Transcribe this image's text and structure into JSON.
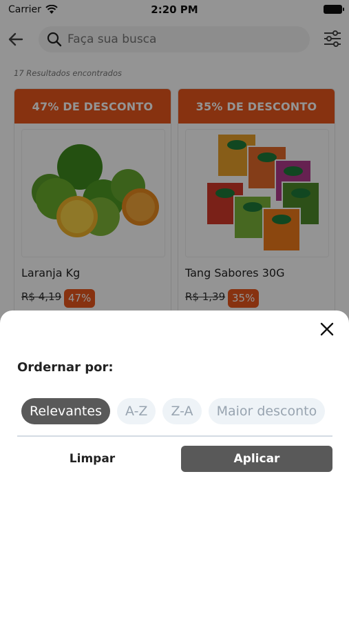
{
  "status_bar": {
    "carrier": "Carrier",
    "time": "2:20 PM"
  },
  "header": {
    "search_placeholder": "Faça sua busca"
  },
  "results_text": "17 Resultados encontrados",
  "products": [
    {
      "banner": "47% DE DESCONTO",
      "name": "Laranja Kg",
      "old_price": "R$ 4,19",
      "discount": "47%",
      "image": "oranges-image"
    },
    {
      "banner": "35% DE DESCONTO",
      "name": "Tang Sabores 30G",
      "old_price": "R$ 1,39",
      "discount": "35%",
      "image": "tang-packets-image"
    }
  ],
  "sheet": {
    "title": "Ordernar por:",
    "options": [
      {
        "label": "Relevantes",
        "selected": true
      },
      {
        "label": "A-Z",
        "selected": false
      },
      {
        "label": "Z-A",
        "selected": false
      },
      {
        "label": "Maior desconto",
        "selected": false
      }
    ],
    "clear_label": "Limpar",
    "apply_label": "Aplicar"
  },
  "colors": {
    "accent": "#e8571c",
    "dark_button": "#595959",
    "chip_inactive_bg": "#eef3f7",
    "chip_inactive_text": "#98a4b0"
  }
}
